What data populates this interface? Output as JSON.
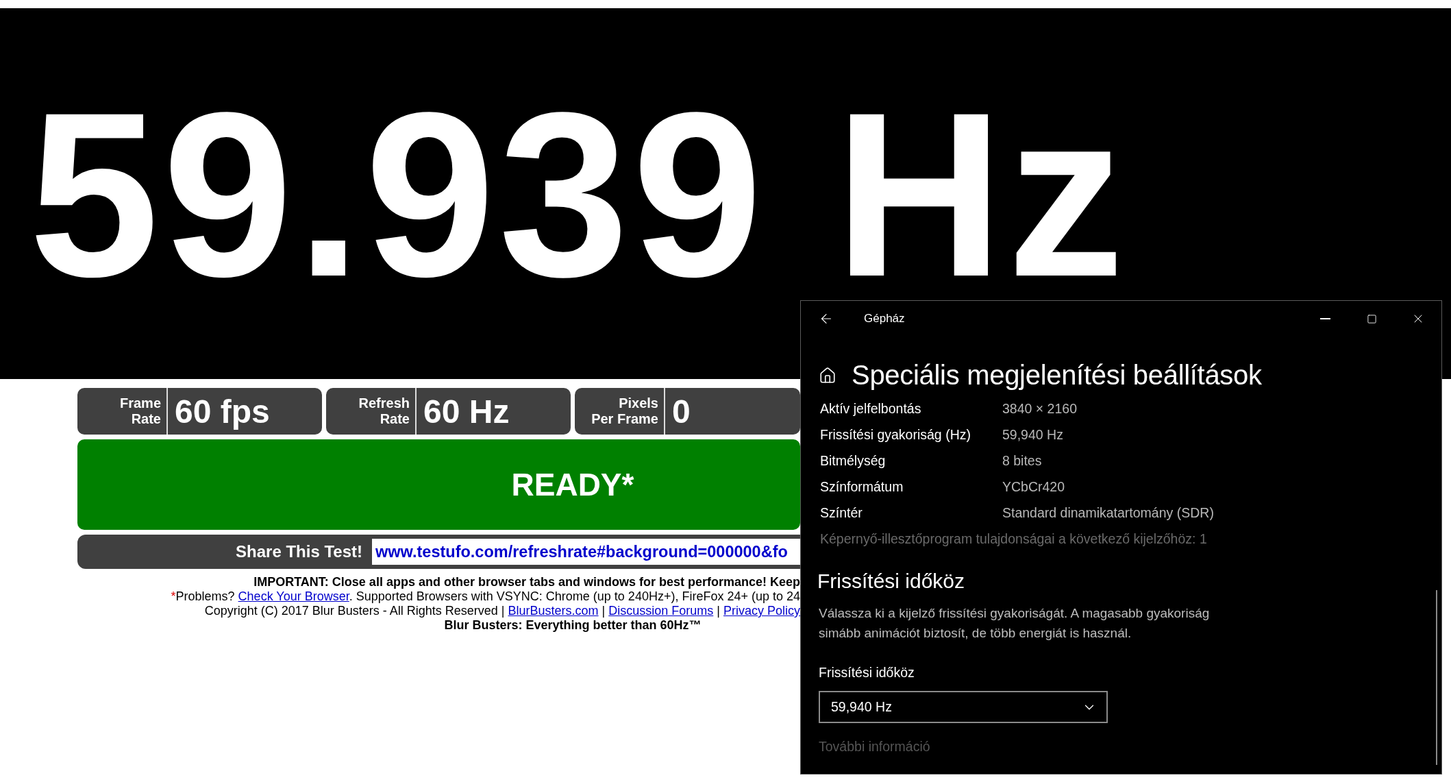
{
  "hero": {
    "reading": "59.939 Hz"
  },
  "stats": [
    {
      "label": "Frame\nRate",
      "value": "60 fps"
    },
    {
      "label": "Refresh\nRate",
      "value": "60 Hz"
    },
    {
      "label": "Pixels\nPer Frame",
      "value": "0"
    }
  ],
  "status": {
    "text": "READY*"
  },
  "share": {
    "label": "Share This Test!",
    "value": "www.testufo.com/refreshrate#background=000000&fo"
  },
  "footer": [
    {
      "kind": "notice",
      "parts": [
        {
          "kind": "text",
          "text": "IMPORTANT: Close all apps and other browser tabs and windows for best performance! Keep"
        }
      ]
    },
    {
      "kind": "info",
      "parts": [
        {
          "kind": "mark",
          "text": "*"
        },
        {
          "kind": "text",
          "text": "Problems? "
        },
        {
          "kind": "link",
          "text": "Check Your Browser"
        },
        {
          "kind": "text",
          "text": ". Supported Browsers with VSYNC: Chrome (up to 240Hz+), FireFox 24+ (up to 24"
        }
      ]
    },
    {
      "kind": "info",
      "parts": [
        {
          "kind": "text",
          "text": "Copyright (C) 2017 Blur Busters - All Rights Reserved | "
        },
        {
          "kind": "link",
          "text": "BlurBusters.com"
        },
        {
          "kind": "text",
          "text": " | "
        },
        {
          "kind": "link",
          "text": "Discussion Forums"
        },
        {
          "kind": "text",
          "text": " | "
        },
        {
          "kind": "link",
          "text": "Privacy Policy"
        }
      ]
    },
    {
      "kind": "tagline",
      "parts": [
        {
          "kind": "text",
          "text": "Blur Busters: Everything better than 60Hz™"
        }
      ]
    }
  ],
  "dialog": {
    "title": "Gépház",
    "heading": "Speciális megjelenítési beállítások",
    "info": [
      {
        "label": "Aktív jelfelbontás",
        "value": "3840 × 2160"
      },
      {
        "label": "Frissítési gyakoriság (Hz)",
        "value": "59,940 Hz"
      },
      {
        "label": "Bitmélység",
        "value": "8 bites"
      },
      {
        "label": "Színformátum",
        "value": "YCbCr420"
      },
      {
        "label": "Színtér",
        "value": "Standard dinamikatartomány (SDR)"
      }
    ],
    "driver_link": "Képernyő-illesztőprogram tulajdonságai a következő kijelzőhöz: 1",
    "section": {
      "title": "Frissítési időköz",
      "description": "Válassza ki a kijelző frissítési gyakoriságát. A magasabb gyakoriság\nsimább animációt biztosít, de több energiát is használ.",
      "field_label": "Frissítési időköz",
      "dropdown": {
        "value": "59,940 Hz"
      },
      "more_link": "További információ"
    }
  }
}
